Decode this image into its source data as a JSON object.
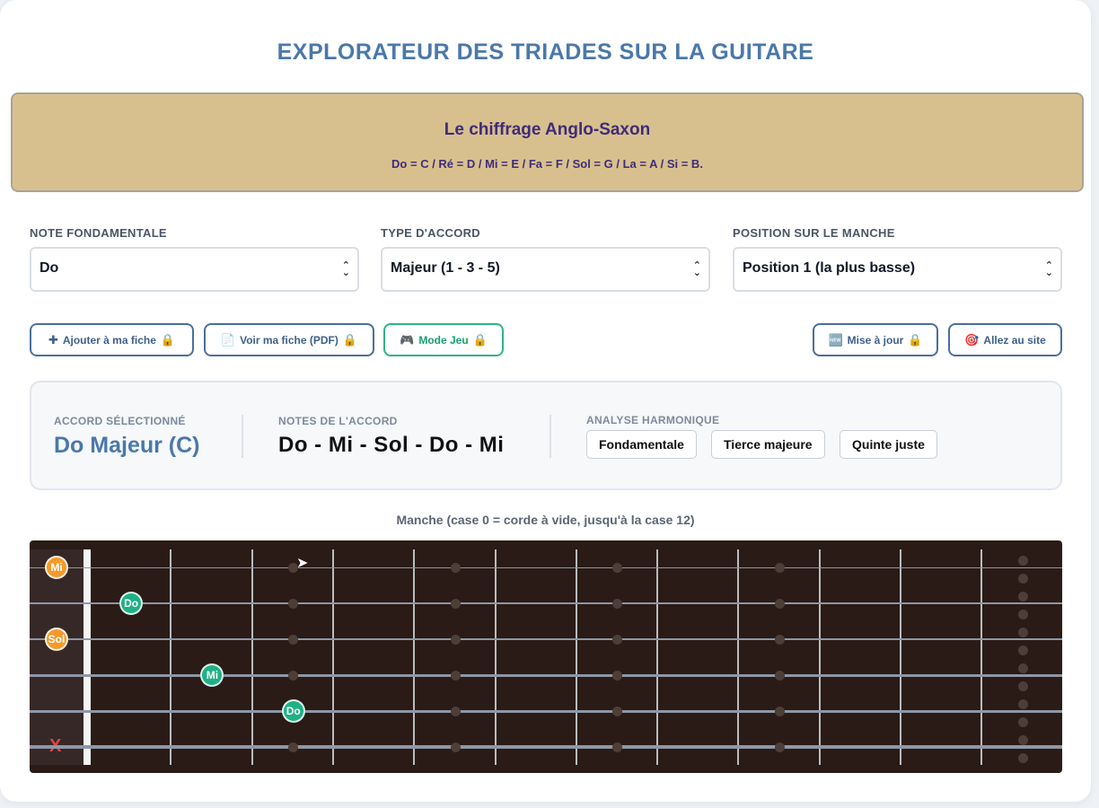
{
  "title": "EXPLORATEUR DES TRIADES SUR LA GUITARE",
  "banner": {
    "title": "Le chiffrage Anglo-Saxon",
    "subtitle": "Do = C / Ré = D / Mi = E / Fa = F / Sol = G / La = A / Si = B."
  },
  "controls": {
    "root": {
      "label": "NOTE FONDAMENTALE",
      "value": "Do"
    },
    "chord_type": {
      "label": "TYPE D'ACCORD",
      "value": "Majeur (1 - 3 - 5)"
    },
    "position": {
      "label": "POSITION SUR LE MANCHE",
      "value": "Position 1 (la plus basse)"
    }
  },
  "actions": {
    "add": {
      "icon": "✚",
      "label": "Ajouter à ma fiche",
      "lock": "🔒"
    },
    "view_pdf": {
      "icon": "📄",
      "label": "Voir ma fiche (PDF)",
      "lock": "🔒"
    },
    "game": {
      "icon": "🎮",
      "label": "Mode Jeu",
      "lock": "🔒"
    },
    "update": {
      "icon": "🆕",
      "label": "Mise à jour",
      "lock": "🔒"
    },
    "site": {
      "icon": "🎯",
      "label": "Allez au site"
    }
  },
  "info": {
    "selected_label": "ACCORD SÉLECTIONNÉ",
    "selected_value": "Do Majeur (C)",
    "notes_label": "NOTES DE L'ACCORD",
    "notes_value": "Do - Mi - Sol - Do - Mi",
    "analysis_label": "ANALYSE HARMONIQUE",
    "intervals": [
      "Fondamentale",
      "Tierce majeure",
      "Quinte juste"
    ]
  },
  "fretboard": {
    "caption": "Manche (case 0 = corde à vide, jusqu'à la case 12)",
    "frets": 12,
    "muted_string": 6,
    "mute_symbol": "X",
    "notes": [
      {
        "string": 1,
        "fret": 0,
        "name": "Mi",
        "color": "#f39a2c"
      },
      {
        "string": 2,
        "fret": 1,
        "name": "Do",
        "color": "#1fb185"
      },
      {
        "string": 3,
        "fret": 0,
        "name": "Sol",
        "color": "#f39a2c"
      },
      {
        "string": 4,
        "fret": 2,
        "name": "Mi",
        "color": "#1fb185"
      },
      {
        "string": 5,
        "fret": 3,
        "name": "Do",
        "color": "#1fb185"
      }
    ]
  }
}
